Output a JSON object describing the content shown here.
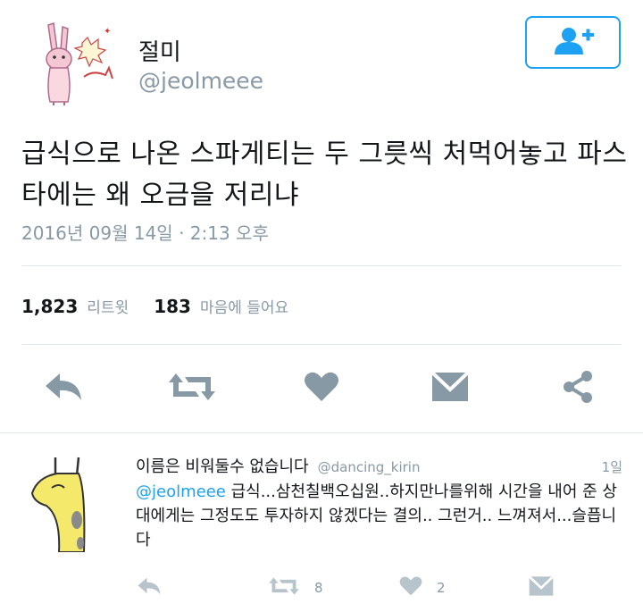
{
  "tweet": {
    "display_name": "절미",
    "handle": "@jeolmeee",
    "text": "급식으로 나온 스파게티는 두 그릇씩 처먹어놓고 파스타에는 왜 오금을 저리냐",
    "timestamp": "2016년 09월 14일 · 2:13 오후",
    "retweet_count": "1,823",
    "retweet_label": "리트윗",
    "like_count": "183",
    "like_label": "마음에 들어요"
  },
  "reply": {
    "display_name": "이름은 비워둘수 없습니다",
    "handle": "@dancing_kirin",
    "time": "1일",
    "mention": "@jeolmeee",
    "text": " 급식...삼천칠백오십원..하지만나를위해 시간을 내어 준 상대에게는 그정도도 투자하지 않겠다는 결의.. 그런거.. 느껴져서...슬픕니다",
    "retweet_count": "8",
    "like_count": "2"
  },
  "icons": {
    "follow": "add-user-icon",
    "reply": "reply-icon",
    "retweet": "retweet-icon",
    "like": "heart-icon",
    "message": "envelope-icon",
    "share": "share-icon"
  },
  "colors": {
    "accent": "#1da1f2",
    "icon_gray": "#8899a6",
    "text": "#14171a",
    "divider": "#e1e8ed"
  }
}
